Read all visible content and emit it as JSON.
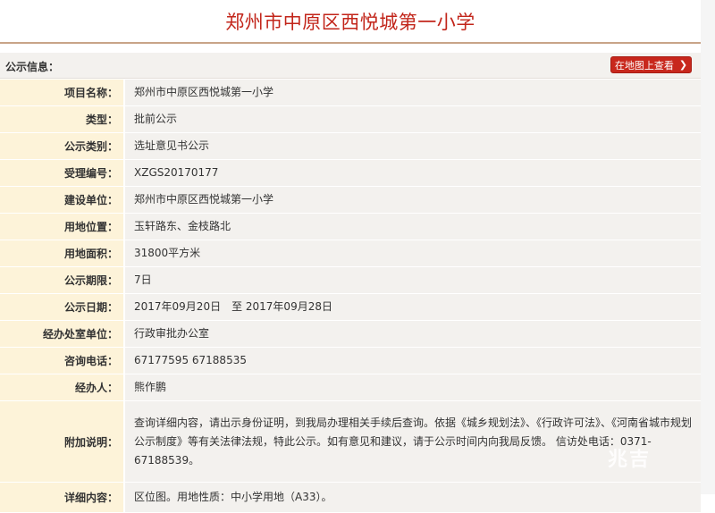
{
  "header": {
    "title": "郑州市中原区西悦城第一小学"
  },
  "section": {
    "label": "公示信息：",
    "map_button": "在地图上查看"
  },
  "rows": [
    {
      "label": "项目名称：",
      "value": "郑州市中原区西悦城第一小学"
    },
    {
      "label": "类型：",
      "value": "批前公示"
    },
    {
      "label": "公示类别：",
      "value": "选址意见书公示"
    },
    {
      "label": "受理编号：",
      "value": "XZGS20170177"
    },
    {
      "label": "建设单位：",
      "value": "郑州市中原区西悦城第一小学"
    },
    {
      "label": "用地位置：",
      "value": "玉轩路东、金枝路北"
    },
    {
      "label": "用地面积：",
      "value": "31800平方米"
    },
    {
      "label": "公示期限：",
      "value": "7日"
    },
    {
      "label": "公示日期：",
      "value": "2017年09月20日　至 2017年09月28日"
    },
    {
      "label": "经办处室单位：",
      "value": "行政审批办公室"
    },
    {
      "label": "咨询电话：",
      "value": "67177595 67188535"
    },
    {
      "label": "经办人：",
      "value": "熊作鹏"
    },
    {
      "label": "附加说明：",
      "value": "查询详细内容，请出示身份证明，到我局办理相关手续后查询。依据《城乡规划法》、《行政许可法》、《河南省城市规划公示制度》等有关法律法规，特此公示。如有意见和建议，请于公示时间内向我局反馈。 信访处电话：0371-67188539。"
    },
    {
      "label": "详细内容：",
      "value": "区位图。用地性质：中小学用地（A33）。"
    }
  ],
  "watermark": "兆吉"
}
